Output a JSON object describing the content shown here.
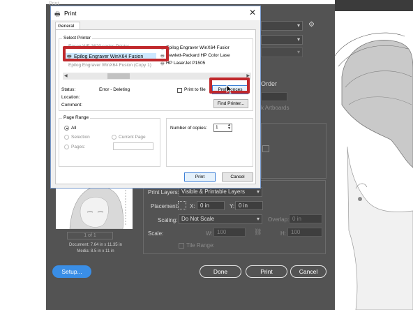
{
  "bg_dialog": {
    "title": "Print",
    "preview": {
      "page_counter": "1 of 1",
      "document_size": "Document: 7.64 in x 11.35 in",
      "media_size": "Media: 8.5 in x 11 in"
    },
    "partial_labels": {
      "order": "Order",
      "artboards": "k Artboards"
    },
    "print_layers_label": "Print Layers:",
    "print_layers_value": "Visible & Printable Layers",
    "placement_label": "Placement:",
    "x_label": "X:",
    "x_value": "0 in",
    "y_label": "Y:",
    "y_value": "0 in",
    "scaling_label": "Scaling:",
    "scaling_value": "Do Not Scale",
    "overlap_label": "Overlap:",
    "overlap_value": "0 in",
    "scale_label": "Scale:",
    "w_label": "W:",
    "w_value": "100",
    "h_label": "H:",
    "h_value": "100",
    "tile_range_label": "Tile Range:",
    "setup_label": "Setup...",
    "done_label": "Done",
    "print_label": "Print",
    "cancel_label": "Cancel"
  },
  "win_dialog": {
    "title": "Print",
    "tab_general": "General",
    "select_printer_label": "Select Printer",
    "printers_left": [
      "Epson WF-3620 series Printer",
      "Epilog Engraver WinX64 Fusion",
      "Epilog Engraver WinX64 Fusion (Copy 1)"
    ],
    "printers_right": [
      "Epilog Engraver WinX64 Fusior",
      "Hewlett-Packard HP Color Lase",
      "HP LaserJet P1505"
    ],
    "status_label": "Status:",
    "status_value": "Error - Deleting",
    "location_label": "Location:",
    "comment_label": "Comment:",
    "print_to_file_label": "Print to file",
    "preferences_label": "Preferences",
    "find_printer_label": "Find Printer...",
    "page_range_label": "Page Range",
    "all_label": "All",
    "selection_label": "Selection",
    "current_page_label": "Current Page",
    "pages_label": "Pages:",
    "copies_label": "Number of copies:",
    "copies_value": "1",
    "print_button_label": "Print",
    "cancel_button_label": "Cancel"
  },
  "colors": {
    "highlight_red": "#c0282c",
    "selection_blue": "#cce8ff",
    "setup_blue": "#3a8ee6",
    "dialog_gray": "#535353"
  }
}
